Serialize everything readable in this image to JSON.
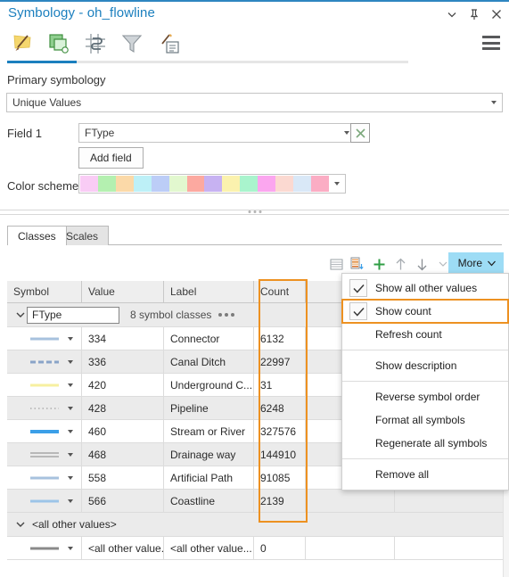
{
  "window": {
    "title": "Symbology - oh_flowline",
    "controls": [
      {
        "name": "menu-chevron",
        "glyph": "chevron-down"
      },
      {
        "name": "pin",
        "glyph": "pin"
      },
      {
        "name": "close",
        "glyph": "close"
      }
    ]
  },
  "toolbar": {
    "items": [
      {
        "name": "symbology-tab-icon",
        "label": "Symbology"
      },
      {
        "name": "vary-symbology-icon",
        "label": "Vary symbology by attribute"
      },
      {
        "name": "masking-icon",
        "label": "Masking"
      },
      {
        "name": "display-filters-icon",
        "label": "Display filters"
      },
      {
        "name": "symbol-layer-drawing-icon",
        "label": "Symbol layer drawing"
      }
    ],
    "overflow_label": "hamburger-menu"
  },
  "primary": {
    "heading": "Primary symbology",
    "symbology_type": "Unique Values",
    "field1_label": "Field 1",
    "field1_value": "FType",
    "expression_button": "expression-button",
    "add_field_label": "Add field",
    "color_scheme_label": "Color scheme",
    "color_scheme_colors": [
      "#f9ccf5",
      "#b4f0b0",
      "#fbd9a8",
      "#bdf0f7",
      "#bccdf7",
      "#e2f8cf",
      "#fca9a0",
      "#c7b2f2",
      "#fbf2ae",
      "#a9f4cd",
      "#fba6ef",
      "#fbd9d1",
      "#d9e8f7",
      "#fbadc4"
    ]
  },
  "tabs": [
    {
      "label": "Classes",
      "active": true
    },
    {
      "label": "Scales",
      "active": false
    }
  ],
  "classes_toolbar": {
    "icons": [
      {
        "name": "list-view-icon"
      },
      {
        "name": "import-symbology-icon"
      },
      {
        "name": "add-value-icon"
      },
      {
        "name": "move-up-icon"
      },
      {
        "name": "move-down-icon"
      },
      {
        "name": "sort-icon"
      }
    ],
    "more_label": "More"
  },
  "table": {
    "headers": [
      "Symbol",
      "Value",
      "Label",
      "Count",
      "",
      ""
    ],
    "group": {
      "field_name": "FType",
      "meta": "8 symbol classes",
      "expanded": true
    },
    "rows": [
      {
        "symbol": {
          "color": "#a7c2de",
          "style": "solid",
          "width": 3
        },
        "value": "334",
        "label": "Connector",
        "count": "6132"
      },
      {
        "symbol": {
          "color": "#8aa4c8",
          "style": "dashed",
          "width": 3
        },
        "value": "336",
        "label": "Canal Ditch",
        "count": "22997"
      },
      {
        "symbol": {
          "color": "#f7f0a0",
          "style": "solid",
          "width": 3
        },
        "value": "420",
        "label": "Underground C...",
        "count": "31"
      },
      {
        "symbol": {
          "color": "#bdbdbd",
          "style": "dotted",
          "width": 3
        },
        "value": "428",
        "label": "Pipeline",
        "count": "6248"
      },
      {
        "symbol": {
          "color": "#3b9fe8",
          "style": "solid",
          "width": 4
        },
        "value": "460",
        "label": "Stream or River",
        "count": "327576"
      },
      {
        "symbol": {
          "color": "#b0b0b0",
          "style": "double",
          "width": 3
        },
        "value": "468",
        "label": "Drainage way",
        "count": "144910"
      },
      {
        "symbol": {
          "color": "#a7c2de",
          "style": "solid",
          "width": 3
        },
        "value": "558",
        "label": "Artificial Path",
        "count": "91085"
      },
      {
        "symbol": {
          "color": "#9cc4e8",
          "style": "solid",
          "width": 3
        },
        "value": "566",
        "label": "Coastline",
        "count": "2139"
      }
    ],
    "other_group": {
      "title": "<all other values>",
      "expanded": true
    },
    "other_row": {
      "symbol": {
        "color": "#8a8a8a",
        "style": "solid",
        "width": 3
      },
      "value": "<all other value...",
      "label": "<all other value...",
      "count": "0"
    }
  },
  "menu": {
    "items": [
      {
        "label": "Show all other values",
        "checked": true,
        "highlighted": false,
        "separator_before": false
      },
      {
        "label": "Show count",
        "checked": true,
        "highlighted": true,
        "separator_before": false
      },
      {
        "label": "Refresh count",
        "checked": false,
        "highlighted": false,
        "separator_before": false
      },
      {
        "label": "Show description",
        "checked": false,
        "highlighted": false,
        "separator_before": true
      },
      {
        "label": "Reverse symbol order",
        "checked": false,
        "highlighted": false,
        "separator_before": true
      },
      {
        "label": "Format all symbols",
        "checked": false,
        "highlighted": false,
        "separator_before": false
      },
      {
        "label": "Regenerate all symbols",
        "checked": false,
        "highlighted": false,
        "separator_before": false
      },
      {
        "label": "Remove all",
        "checked": false,
        "highlighted": false,
        "separator_before": true
      }
    ]
  },
  "colors": {
    "accent": "#1b7fbe",
    "highlight": "#ed9121",
    "more_button_bg": "#9ddcf5"
  }
}
